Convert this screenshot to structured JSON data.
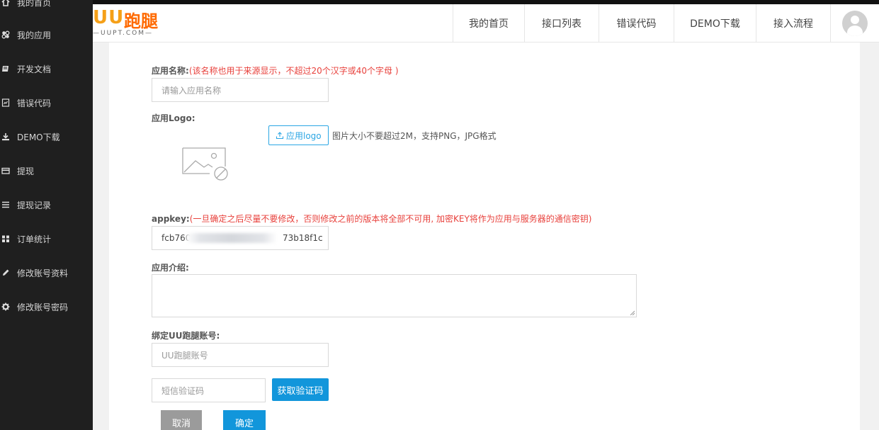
{
  "sidebar": {
    "items": [
      {
        "label": "我的首页",
        "icon": "home-icon"
      },
      {
        "label": "我的应用",
        "icon": "apps-icon"
      },
      {
        "label": "开发文档",
        "icon": "book-icon"
      },
      {
        "label": "错误代码",
        "icon": "error-doc-icon"
      },
      {
        "label": "DEMO下载",
        "icon": "download-icon"
      },
      {
        "label": "提现",
        "icon": "card-icon"
      },
      {
        "label": "提现记录",
        "icon": "list-icon"
      },
      {
        "label": "订单统计",
        "icon": "grid-icon"
      },
      {
        "label": "修改账号资料",
        "icon": "pencil-icon"
      },
      {
        "label": "修改账号密码",
        "icon": "gear-icon"
      }
    ]
  },
  "header": {
    "logo_text": "UU",
    "logo_run": "跑腿",
    "logo_sub": "—UUPT.COM—",
    "nav": [
      {
        "label": "我的首页"
      },
      {
        "label": "接口列表"
      },
      {
        "label": "错误代码"
      },
      {
        "label": "DEMO下载"
      },
      {
        "label": "接入流程"
      }
    ]
  },
  "form": {
    "app_name_label": "应用名称:",
    "app_name_hint": "(该名称也用于来源显示，不超过20个汉字或40个字母 )",
    "app_name_placeholder": "请输入应用名称",
    "logo_label": "应用Logo:",
    "upload_label": "应用logo",
    "upload_note": "图片大小不要超过2M，支持PNG，JPG格式",
    "appkey_label": "appkey:",
    "appkey_hint": "(一旦确定之后尽量不要修改，否则修改之前的版本将全部不可用, 加密KEY将作为应用与服务器的通信密钥)",
    "appkey_prefix": "fcb760",
    "appkey_suffix": "73b18f1c",
    "intro_label": "应用介绍:",
    "bind_label": "绑定UU跑腿账号:",
    "bind_placeholder": "UU跑腿账号",
    "sms_placeholder": "短信验证码",
    "get_code_label": "获取验证码",
    "cancel_label": "取消",
    "confirm_label": "确定"
  },
  "colors": {
    "accent": "#1296db",
    "hint_red": "#e8413c",
    "sidebar_bg": "#1f1f1f",
    "logo_orange": "#ff6a00"
  }
}
